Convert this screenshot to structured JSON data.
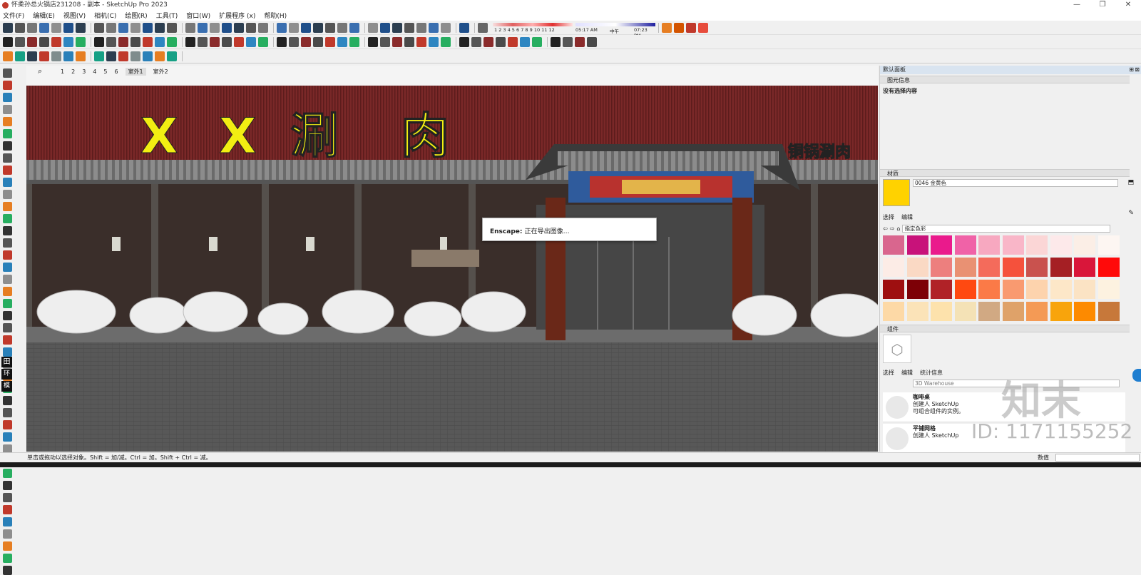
{
  "window": {
    "title": "怀柔孙总火锅店231208 - 副本 - SketchUp Pro 2023",
    "controls": [
      "—",
      "❐",
      "✕"
    ]
  },
  "menu": [
    "文件(F)",
    "编辑(E)",
    "视图(V)",
    "相机(C)",
    "绘图(R)",
    "工具(T)",
    "窗口(W)",
    "扩展程序 (x)",
    "帮助(H)"
  ],
  "shadow": {
    "months": "1 2 3 4 5 6 7 8 9 10 11 12",
    "time_start": "05:17 AM",
    "time_mid": "中午",
    "time_end": "07:23 PM"
  },
  "scene_tabs": [
    "1",
    "2",
    "3",
    "4",
    "5",
    "6",
    "室外1",
    "室外2"
  ],
  "active_tab": "室外1",
  "model": {
    "sign_letters": [
      "X",
      "X",
      "涮",
      "肉"
    ],
    "sign_right": "铜锅涮肉"
  },
  "dialog": {
    "label": "Enscape:",
    "message": "正在导出图像…"
  },
  "panel": {
    "title": "默认面板",
    "entity_info": {
      "header": "图元信息",
      "text": "没有选择内容"
    },
    "materials": {
      "header": "材质",
      "current_name": "0046 金黄色",
      "current_color": "#ffd200",
      "tabs": [
        "选择",
        "编辑"
      ],
      "library": "指定色彩",
      "swatches": [
        "#d9668e",
        "#c8127a",
        "#ea1a8c",
        "#f062a7",
        "#f7a8c0",
        "#f9b6c8",
        "#fbd6d6",
        "#fde9ea",
        "#fbeee6",
        "#fdf6f2",
        "#fcece6",
        "#fad9c4",
        "#ed7f7e",
        "#e99173",
        "#f46b5b",
        "#f5513c",
        "#c9524e",
        "#a51f24",
        "#d9163a",
        "#ff0a0a",
        "#9e0f10",
        "#7d0006",
        "#b02227",
        "#ff4911",
        "#fb7a47",
        "#f99a70",
        "#fdd3ad",
        "#fde7c8",
        "#fbe3c4",
        "#fdf2e0",
        "#fdd9a6",
        "#fbe3b8",
        "#fde2ac",
        "#f4e2b6",
        "#d1a983",
        "#dfa269",
        "#f49a55",
        "#f8a40c",
        "#fd8a00",
        "#c7783a"
      ]
    },
    "components": {
      "header": "组件",
      "tabs": [
        "选择",
        "编辑",
        "统计信息"
      ],
      "search_placeholder": "3D Warehouse",
      "items": [
        {
          "name": "咖啡桌",
          "author": "创建人 SketchUp",
          "desc": "可组合组件的实例。"
        },
        {
          "name": "平铺网格",
          "author": "创建人 SketchUp",
          "desc": ""
        }
      ]
    }
  },
  "watermark": {
    "brand": "知末",
    "id": "ID: 1171155252"
  },
  "status": {
    "hint": "单击或拖动以选择对象。Shift = 加/减。Ctrl = 加。Shift + Ctrl = 减。",
    "value_label": "数值"
  }
}
